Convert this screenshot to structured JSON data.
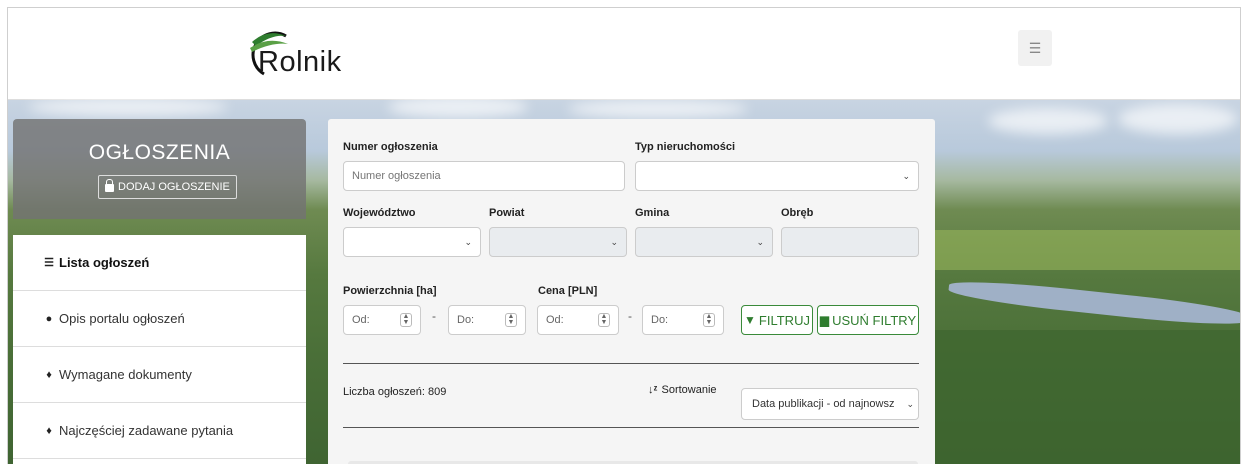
{
  "header": {
    "logo_text": "Rolnik",
    "menu_icon": "hamburger-icon"
  },
  "sidebar": {
    "title": "OGŁOSZENIA",
    "add_button": "DODAJ OGŁOSZENIE",
    "items": [
      {
        "label": "Lista ogłoszeń",
        "icon": "list-icon"
      },
      {
        "label": "Opis portalu ogłoszeń",
        "icon": "info-icon"
      },
      {
        "label": "Wymagane dokumenty",
        "icon": "lightbulb-icon"
      },
      {
        "label": "Najczęściej zadawane pytania",
        "icon": "lightbulb-icon"
      }
    ]
  },
  "filters": {
    "numer_label": "Numer ogłoszenia",
    "numer_placeholder": "Numer ogłoszenia",
    "typ_label": "Typ nieruchomości",
    "typ_value": "",
    "wojewodztwo_label": "Województwo",
    "powiat_label": "Powiat",
    "gmina_label": "Gmina",
    "obreb_label": "Obręb",
    "powierzchnia_label": "Powierzchnia [ha]",
    "cena_label": "Cena [PLN]",
    "od": "Od:",
    "do": "Do:",
    "filtruj": "FILTRUJ",
    "usun": "USUŃ FILTRY"
  },
  "results": {
    "count_label": "Liczba ogłoszeń: 809",
    "sort_label": "Sortowanie",
    "sort_value": "Data publikacji - od najnowsz"
  },
  "colors": {
    "accent_green": "#2f7d2f"
  }
}
